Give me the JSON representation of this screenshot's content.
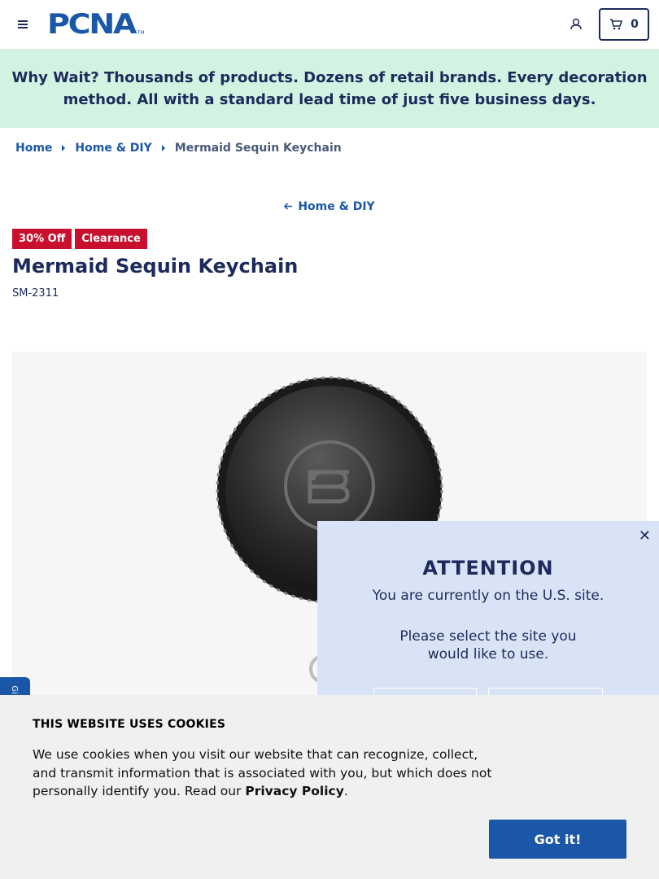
{
  "header": {
    "logo_text": "PCNA",
    "logo_tm": "TM",
    "cart_count": "0",
    "menu_icon": "hamburger-icon",
    "account_icon": "user-icon",
    "cart_icon": "cart-icon"
  },
  "promo": {
    "lead": "Why Wait?",
    "text": " Thousands of products. Dozens of retail brands. Every decoration method. All with a standard lead time of just five business days."
  },
  "breadcrumb": {
    "items": [
      "Home",
      "Home & DIY"
    ],
    "current": "Mermaid Sequin Keychain"
  },
  "back_link": "Home & DIY",
  "product": {
    "badges": [
      "30% Off",
      "Clearance"
    ],
    "title": "Mermaid Sequin Keychain",
    "sku": "SM-2311"
  },
  "side_tab": "Gi",
  "attention": {
    "title": "ATTENTION",
    "subtitle": "You are currently on the U.S. site.",
    "select_line1": "Please select the site you",
    "select_line2": "would like to use.",
    "close": "✕"
  },
  "cookie": {
    "title": "THIS WEBSITE USES COOKIES",
    "text": "We use cookies when you visit our website that can recognize, collect, and transmit information that is associated with you, but which does not personally identify you. Read our ",
    "link": "Privacy Policy",
    "end": ".",
    "button": "Got it!"
  },
  "colors": {
    "brand_blue": "#1b57a8",
    "navy": "#1d2a5c",
    "promo_bg": "#d2f3e1",
    "badge_red": "#c8102e",
    "attention_bg": "#d8e4f6"
  }
}
